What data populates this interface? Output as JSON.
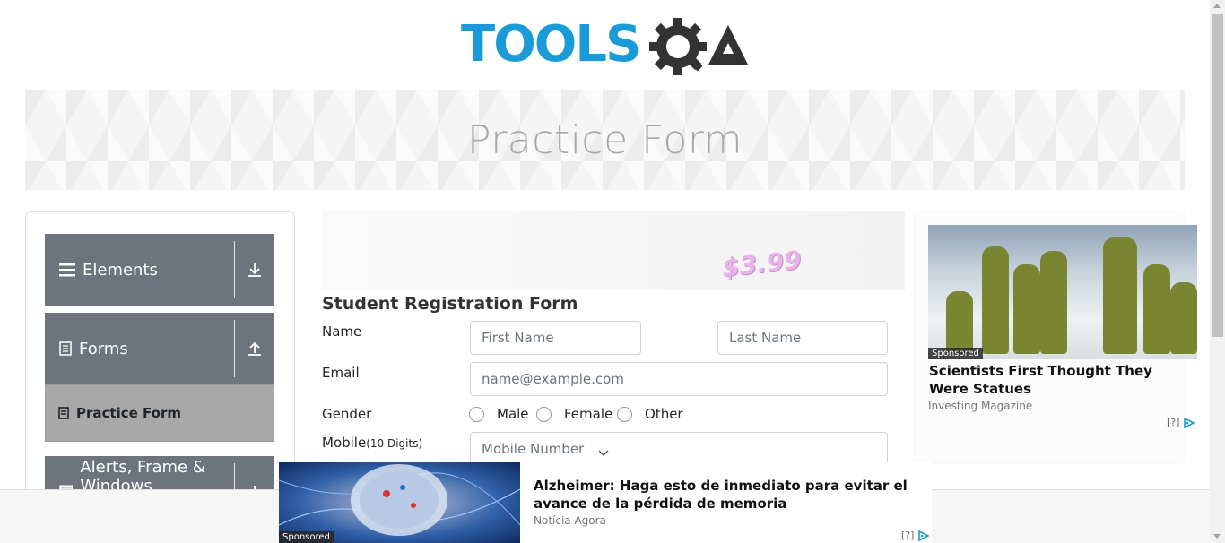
{
  "header": {
    "logo_text": "TOOLSQA"
  },
  "banner": {
    "title": "Practice Form"
  },
  "sidebar": {
    "groups": [
      {
        "label": "Elements",
        "icon": "hamburger-icon",
        "state_icon": "download-arrow-icon"
      },
      {
        "label": "Forms",
        "icon": "document-icon",
        "state_icon": "upload-arrow-icon"
      },
      {
        "label": "Alerts, Frame & Windows",
        "icon": "window-icon",
        "state_icon": "download-arrow-icon"
      }
    ],
    "active_item": {
      "label": "Practice Form",
      "icon": "form-icon"
    }
  },
  "top_ad": {
    "price": "$3.99"
  },
  "form": {
    "title": "Student Registration Form",
    "name_label": "Name",
    "first_name_placeholder": "First Name",
    "last_name_placeholder": "Last Name",
    "email_label": "Email",
    "email_placeholder": "name@example.com",
    "gender_label": "Gender",
    "gender_options": [
      "Male",
      "Female",
      "Other"
    ],
    "mobile_label": "Mobile",
    "mobile_hint": "(10 Digits)",
    "mobile_placeholder": "Mobile Number"
  },
  "right_ad": {
    "sponsored": "Sponsored",
    "headline": "Scientists First Thought They Were Statues",
    "source": "Investing Magazine",
    "adchoice": "[?]"
  },
  "bottom_ad": {
    "sponsored": "Sponsored",
    "headline": "Alzheimer: Haga esto de inmediato para evitar el avance de la pérdida de memoria",
    "source": "Notícia Agora",
    "adchoice": "[?]"
  },
  "colors": {
    "brand_blue": "#1a9bd7",
    "brand_dark": "#333333",
    "sidebar_group": "#6c757d",
    "active_item": "#a8a8a8"
  }
}
